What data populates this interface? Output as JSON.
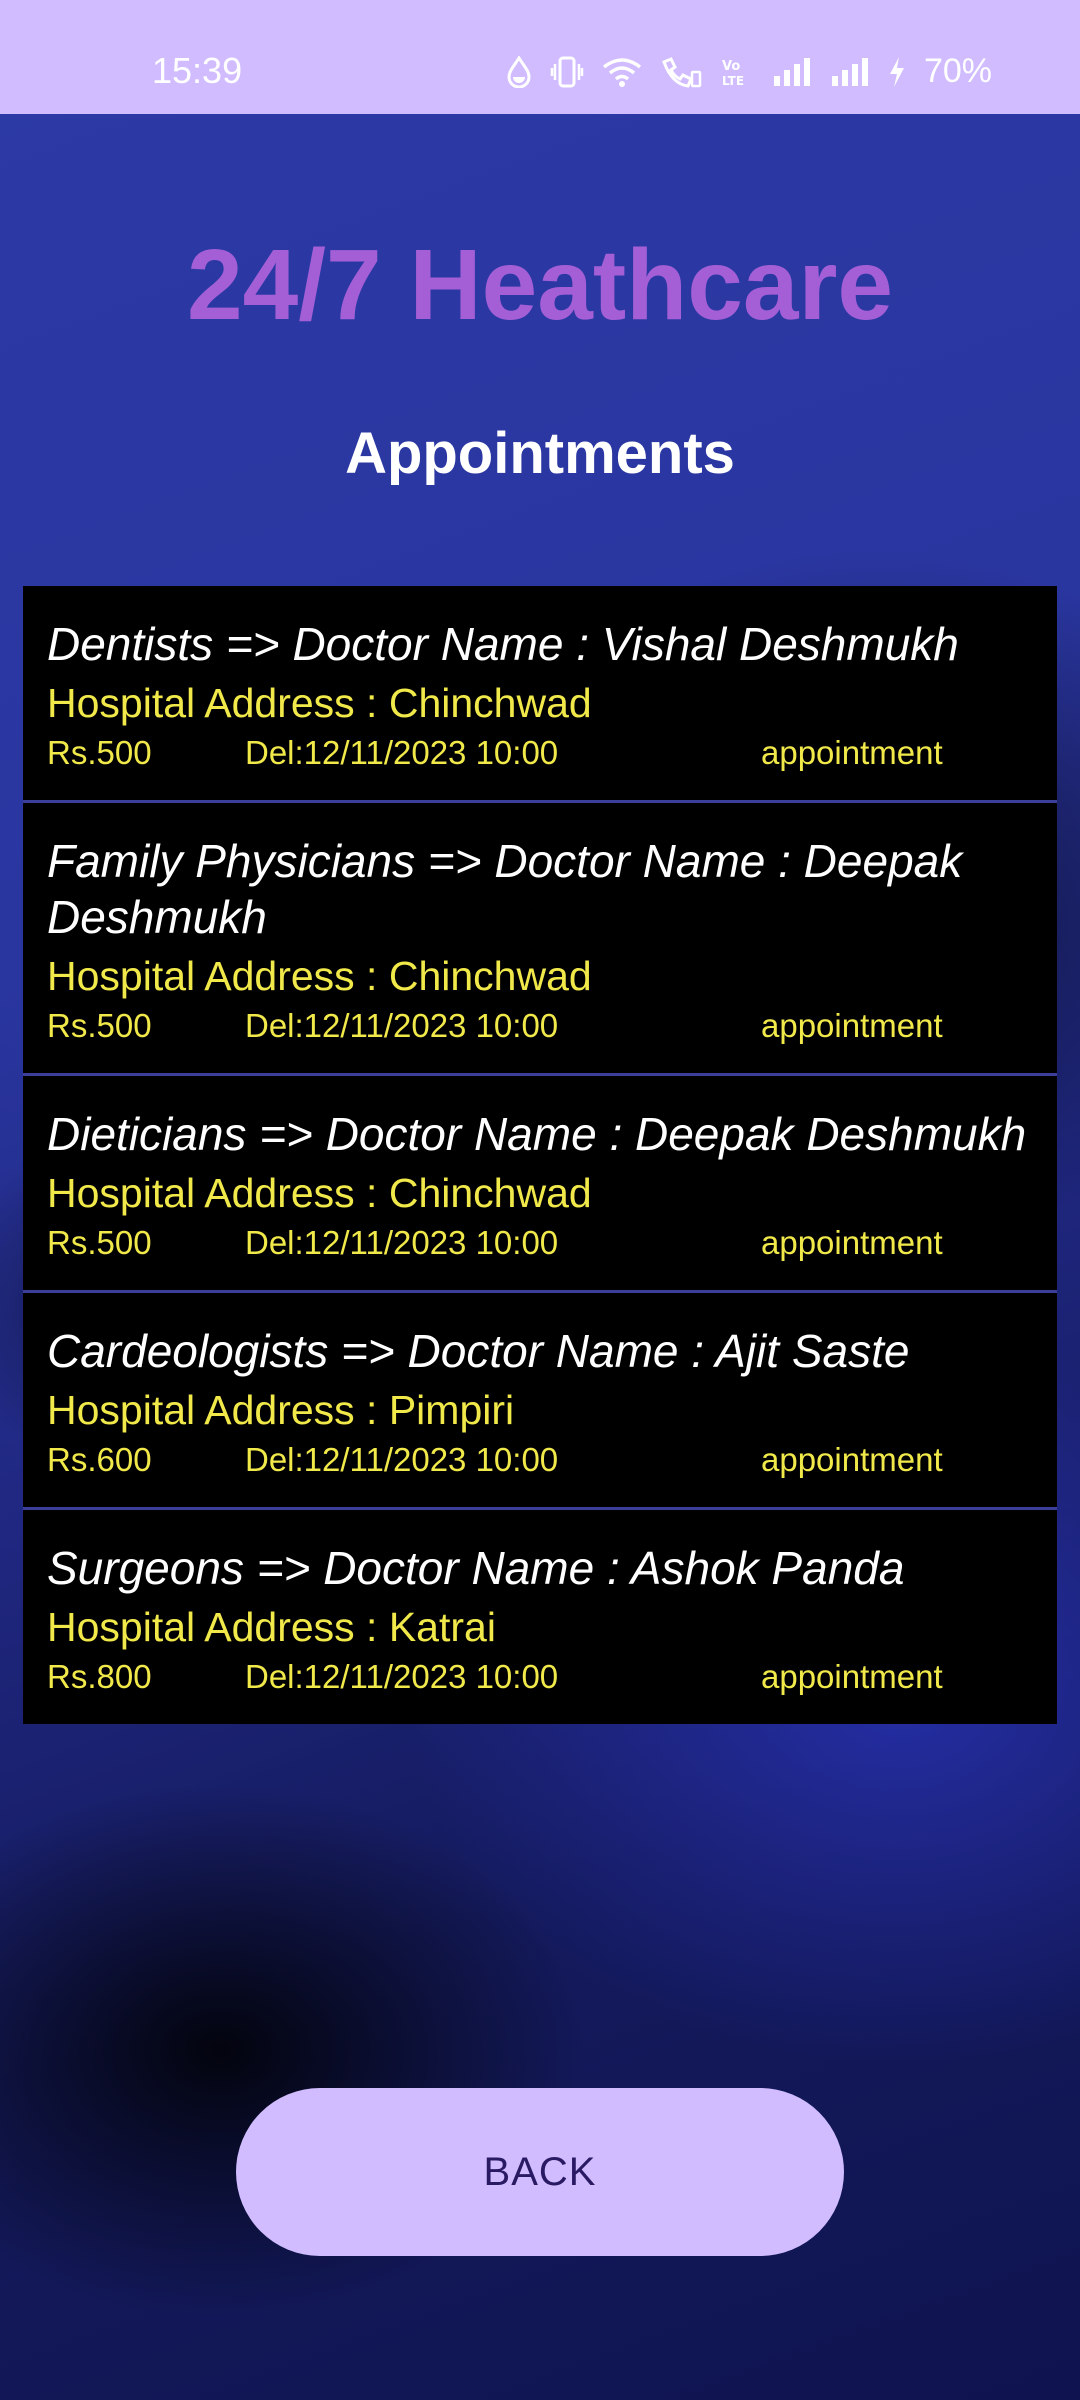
{
  "status_bar": {
    "time": "15:39",
    "battery": "70%",
    "icons": [
      "water-drop-icon",
      "vibrate-icon",
      "wifi-icon",
      "wifi-calling-icon",
      "volte-icon",
      "signal-icon",
      "signal-icon",
      "charging-icon"
    ]
  },
  "app": {
    "title": "24/7 Heathcare",
    "section_title": "Appointments"
  },
  "appointments": [
    {
      "doctor": "Dentists => Doctor Name : Vishal Deshmukh",
      "address": "Hospital Address : Chinchwad",
      "fee": "Rs.500",
      "date": "Del:12/11/2023 10:00",
      "label": "appointment"
    },
    {
      "doctor": "Family Physicians => Doctor Name : Deepak Deshmukh",
      "address": "Hospital Address : Chinchwad",
      "fee": "Rs.500",
      "date": "Del:12/11/2023 10:00",
      "label": "appointment"
    },
    {
      "doctor": "Dieticians => Doctor Name : Deepak Deshmukh",
      "address": "Hospital Address : Chinchwad",
      "fee": "Rs.500",
      "date": "Del:12/11/2023 10:00",
      "label": "appointment"
    },
    {
      "doctor": "Cardeologists => Doctor Name : Ajit Saste",
      "address": "Hospital Address : Pimpiri",
      "fee": "Rs.600",
      "date": "Del:12/11/2023 10:00",
      "label": "appointment"
    },
    {
      "doctor": "Surgeons => Doctor Name : Ashok Panda",
      "address": "Hospital Address : Katrai",
      "fee": "Rs.800",
      "date": "Del:12/11/2023 10:00",
      "label": "appointment"
    }
  ],
  "back_button": {
    "label": "BACK"
  },
  "colors": {
    "accent": "#d0bcff",
    "title": "#a45fd6",
    "address_text": "#f1e94a",
    "card_background": "#000000"
  }
}
